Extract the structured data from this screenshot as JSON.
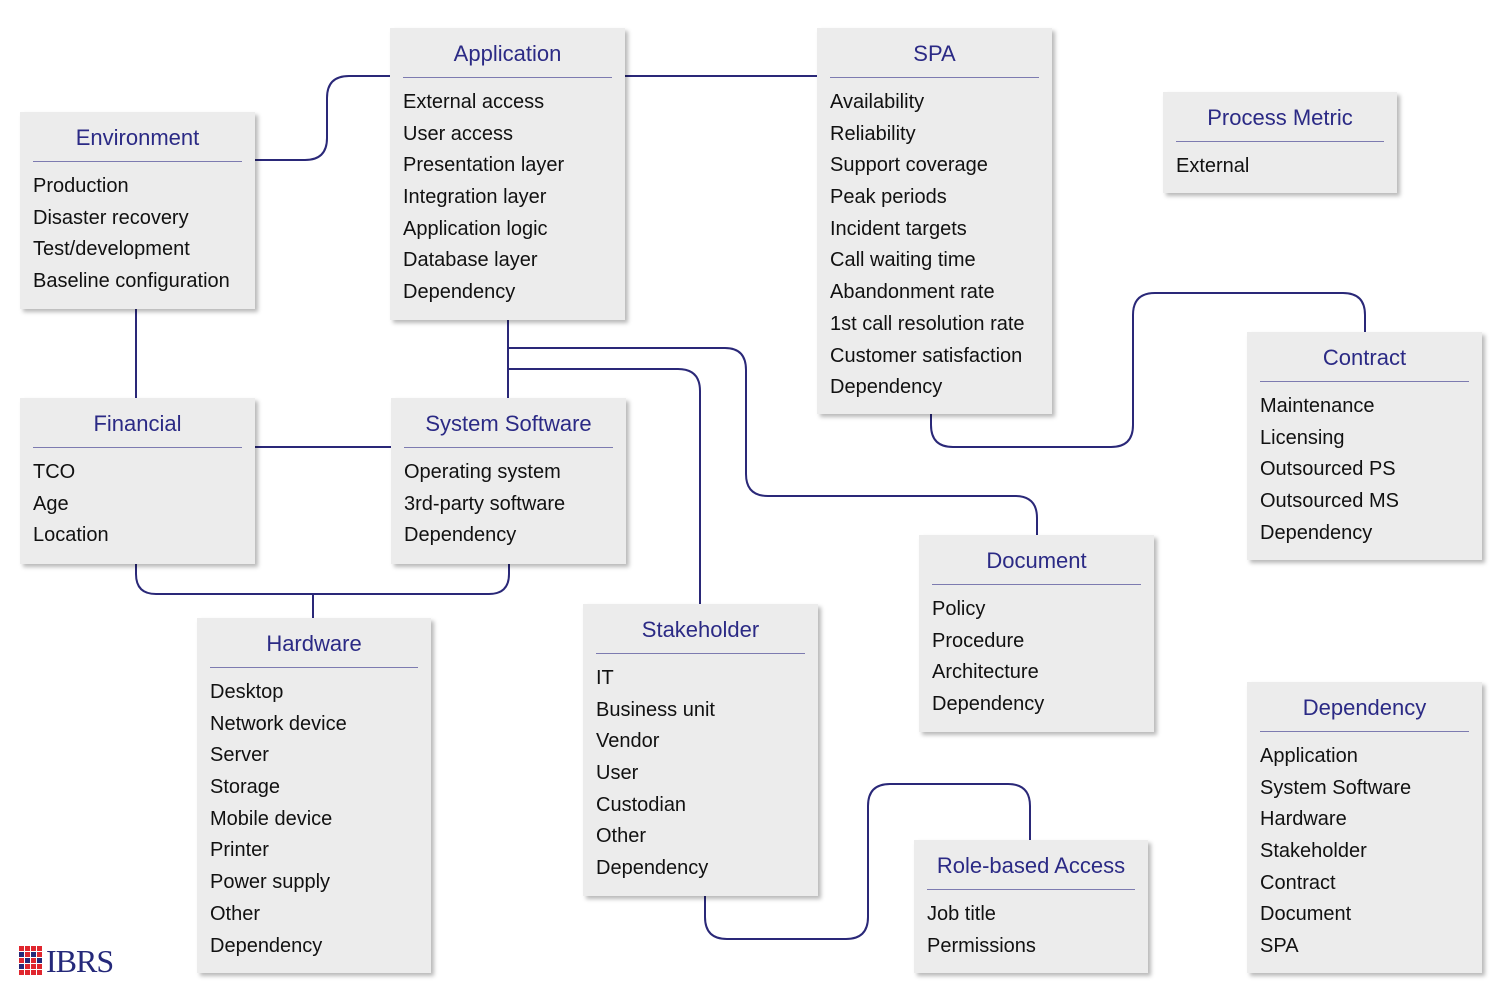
{
  "colors": {
    "title": "#2b2a85",
    "connector": "#2a2878",
    "box": "#ececec",
    "logo_red": "#e0262e",
    "logo_blue": "#25297a"
  },
  "logo": {
    "text": "IBRS"
  },
  "boxes": {
    "environment": {
      "title": "Environment",
      "items": [
        "Production",
        "Disaster recovery",
        "Test/development",
        "Baseline configuration"
      ]
    },
    "application": {
      "title": "Application",
      "items": [
        "External access",
        "User access",
        "Presentation layer",
        "Integration layer",
        "Application logic",
        "Database layer",
        "Dependency"
      ]
    },
    "spa": {
      "title": "SPA",
      "items": [
        "Availability",
        "Reliability",
        "Support coverage",
        "Peak periods",
        "Incident targets",
        "Call waiting time",
        "Abandonment rate",
        "1st call resolution rate",
        "Customer satisfaction",
        "Dependency"
      ]
    },
    "process_metric": {
      "title": "Process Metric",
      "items": [
        "External"
      ]
    },
    "financial": {
      "title": "Financial",
      "items": [
        "TCO",
        "Age",
        "Location"
      ]
    },
    "system_software": {
      "title": "System Software",
      "items": [
        "Operating system",
        "3rd-party software",
        "Dependency"
      ]
    },
    "contract": {
      "title": "Contract",
      "items": [
        "Maintenance",
        "Licensing",
        "Outsourced PS",
        "Outsourced MS",
        "Dependency"
      ]
    },
    "document": {
      "title": "Document",
      "items": [
        "Policy",
        "Procedure",
        "Architecture",
        "Dependency"
      ]
    },
    "hardware": {
      "title": "Hardware",
      "items": [
        "Desktop",
        "Network device",
        "Server",
        "Storage",
        "Mobile device",
        "Printer",
        "Power supply",
        "Other",
        "Dependency"
      ]
    },
    "stakeholder": {
      "title": "Stakeholder",
      "items": [
        "IT",
        "Business unit",
        "Vendor",
        "User",
        "Custodian",
        "Other",
        "Dependency"
      ]
    },
    "role_based_access": {
      "title": "Role-based Access",
      "items": [
        "Job title",
        "Permissions"
      ]
    },
    "dependency": {
      "title": "Dependency",
      "items": [
        "Application",
        "System Software",
        "Hardware",
        "Stakeholder",
        "Contract",
        "Document",
        "SPA"
      ]
    }
  },
  "connections": [
    [
      "environment",
      "application"
    ],
    [
      "application",
      "spa"
    ],
    [
      "environment",
      "financial"
    ],
    [
      "financial",
      "system_software"
    ],
    [
      "application",
      "system_software"
    ],
    [
      "application",
      "document"
    ],
    [
      "application",
      "stakeholder"
    ],
    [
      "financial",
      "hardware"
    ],
    [
      "system_software",
      "hardware"
    ],
    [
      "spa",
      "contract"
    ],
    [
      "stakeholder",
      "role_based_access"
    ]
  ]
}
